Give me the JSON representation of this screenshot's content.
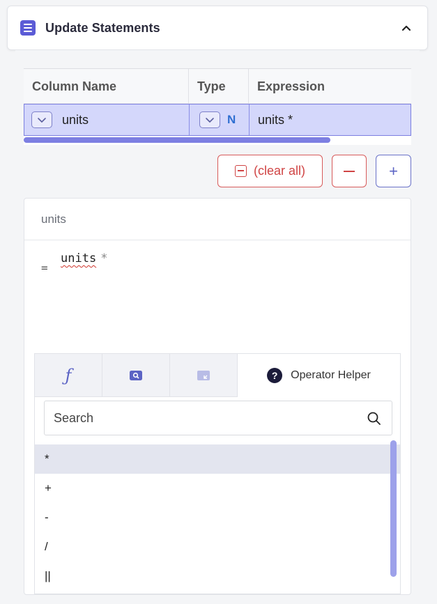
{
  "header": {
    "title": "Update Statements",
    "icon": "list-icon",
    "toggle_icon": "chevron-up-icon",
    "accent_color": "#5b5bd6"
  },
  "grid": {
    "columns": [
      "Column Name",
      "Type",
      "Expression"
    ],
    "rows": [
      {
        "column_name": "units",
        "type": "N",
        "expression": "units *"
      }
    ],
    "selected_row_color": "#d4d7fb"
  },
  "actions": {
    "clear_all_label": "(clear all)",
    "remove_icon": "minus-icon",
    "add_icon": "plus-icon",
    "add_label": "+"
  },
  "editor": {
    "column_label": "units",
    "equals_sign": "=",
    "expression_word": "units",
    "expression_operator": "*"
  },
  "helper": {
    "tabs": [
      {
        "icon": "function-icon",
        "label": "ƒ"
      },
      {
        "icon": "search-box-icon"
      },
      {
        "icon": "expand-icon"
      },
      {
        "icon": "question-circle-icon",
        "label": "Operator Helper",
        "active": true
      }
    ],
    "question_glyph": "?",
    "search_placeholder": "Search",
    "operators": [
      "*",
      "+",
      "-",
      "/",
      "||"
    ],
    "selected_operator": "*"
  }
}
